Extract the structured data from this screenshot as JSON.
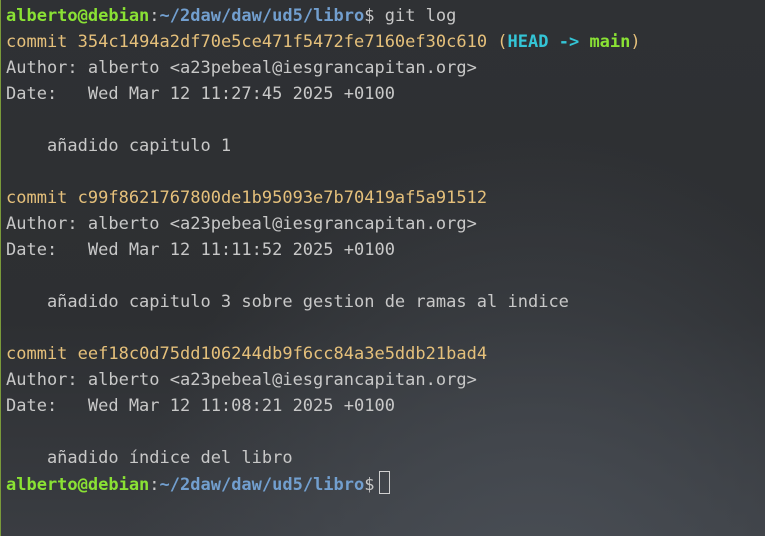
{
  "prompt": {
    "user_host": "alberto@debian",
    "colon": ":",
    "path": "~/2daw/daw/ud5/libro",
    "dollar": "$"
  },
  "command": " git log",
  "commits": [
    {
      "label": "commit ",
      "hash": "354c1494a2df70e5ce471f5472fe7160ef30c610",
      "refs_open": " (",
      "head": "HEAD -> ",
      "branch": "main",
      "refs_close": ")",
      "author": "Author: alberto <a23pebeal@iesgrancapitan.org>",
      "date": "Date:   Wed Mar 12 11:27:45 2025 +0100",
      "message": "    añadido capitulo 1"
    },
    {
      "label": "commit ",
      "hash": "c99f8621767800de1b95093e7b70419af5a91512",
      "author": "Author: alberto <a23pebeal@iesgrancapitan.org>",
      "date": "Date:   Wed Mar 12 11:11:52 2025 +0100",
      "message": "    añadido capitulo 3 sobre gestion de ramas al indice"
    },
    {
      "label": "commit ",
      "hash": "eef18c0d75dd106244db9f6cc84a3e5ddb21bad4",
      "author": "Author: alberto <a23pebeal@iesgrancapitan.org>",
      "date": "Date:   Wed Mar 12 11:08:21 2025 +0100",
      "message": "    añadido índice del libro"
    }
  ],
  "colors": {
    "background": "#2b2d30",
    "user_host": "#8ae234",
    "path": "#729fcf",
    "commit": "#e5c07b",
    "head": "#34c5d6",
    "branch": "#8ae234",
    "text": "#c8c8c8"
  }
}
